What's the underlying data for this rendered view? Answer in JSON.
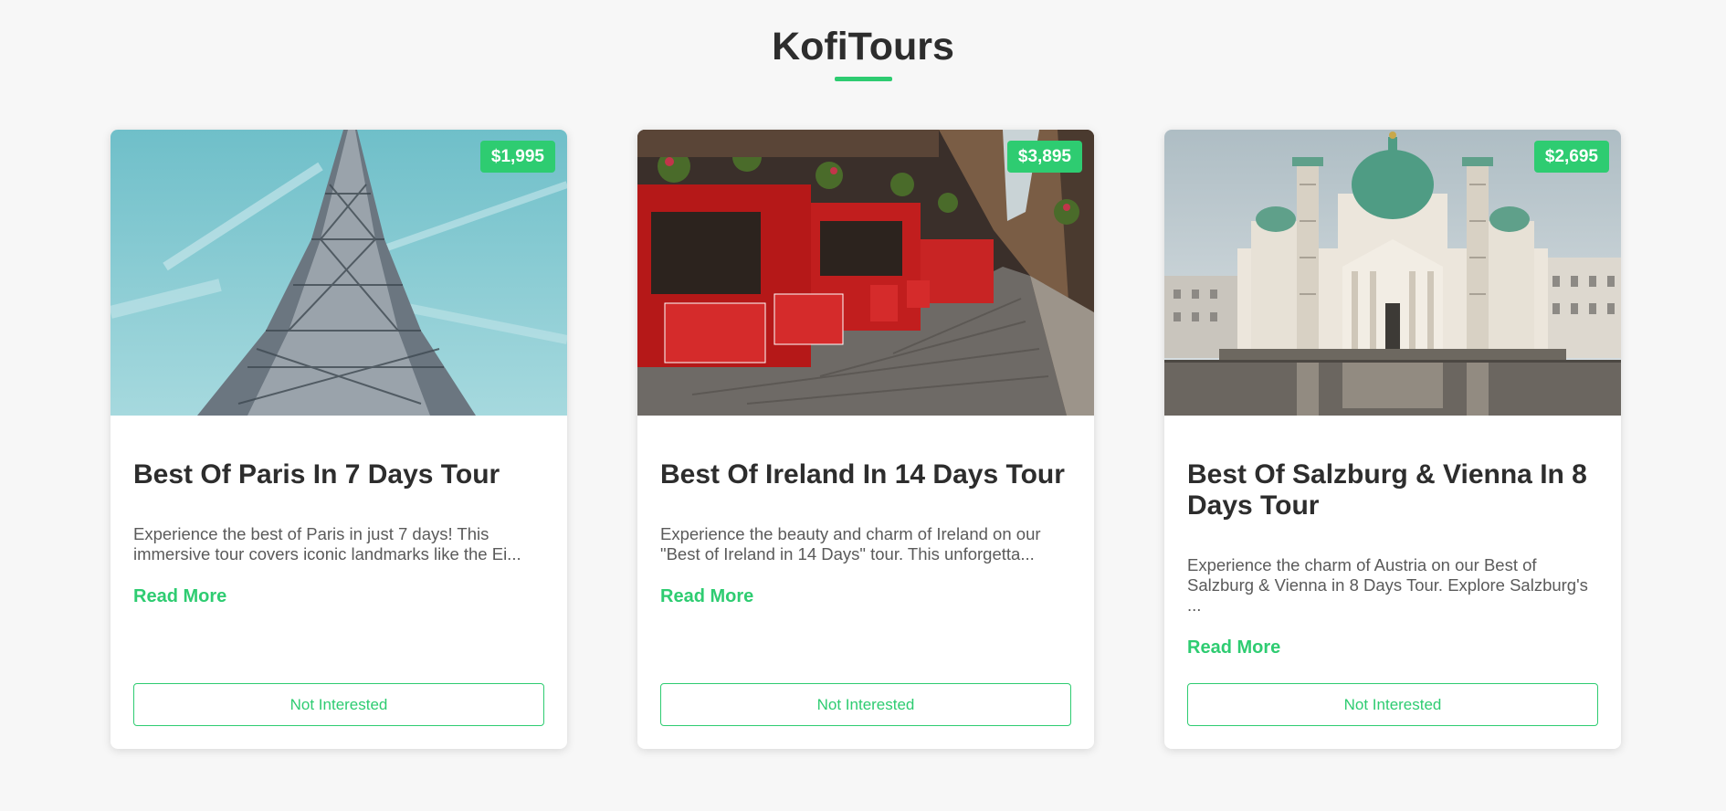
{
  "site": {
    "title": "KofiTours",
    "accent_color": "#2ecc71"
  },
  "tours": [
    {
      "price": "$1,995",
      "title": "Best Of Paris In 7 Days Tour",
      "description": "Experience the best of Paris in just 7 days! This immersive tour covers iconic landmarks like the Ei...",
      "read_more": "Read More",
      "button": "Not Interested",
      "image": "eiffel-tower-photo"
    },
    {
      "price": "$3,895",
      "title": "Best Of Ireland In 14 Days Tour",
      "description": "Experience the beauty and charm of Ireland on our \"Best of Ireland in 14 Days\" tour. This unforgetta...",
      "read_more": "Read More",
      "button": "Not Interested",
      "image": "temple-bar-street-photo"
    },
    {
      "price": "$2,695",
      "title": "Best Of Salzburg & Vienna In 8 Days Tour",
      "description": "Experience the charm of Austria on our Best of Salzburg & Vienna in 8 Days Tour. Explore Salzburg's ...",
      "read_more": "Read More",
      "button": "Not Interested",
      "image": "karlskirche-photo"
    }
  ]
}
